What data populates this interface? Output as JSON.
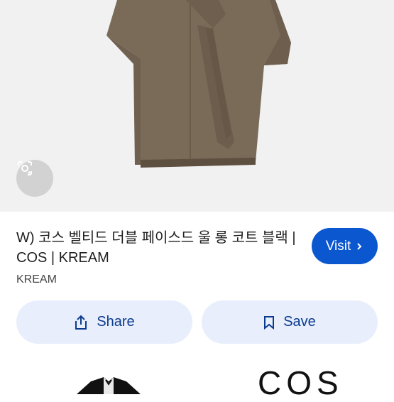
{
  "product": {
    "title": "W) 코스 벨티드 더블 페이스드 울 롱 코트 블랙 | COS | KREAM",
    "source": "KREAM"
  },
  "actions": {
    "visit_label": "Visit",
    "share_label": "Share",
    "save_label": "Save"
  },
  "related": {
    "brand_text": "COS"
  },
  "colors": {
    "accent": "#0b57d0",
    "pill_bg": "#e8eefc",
    "coat": "#7a6a58"
  },
  "icons": {
    "lens": "google-lens-icon",
    "visit": "chevron-right-icon",
    "share": "share-icon",
    "save": "bookmark-icon"
  }
}
